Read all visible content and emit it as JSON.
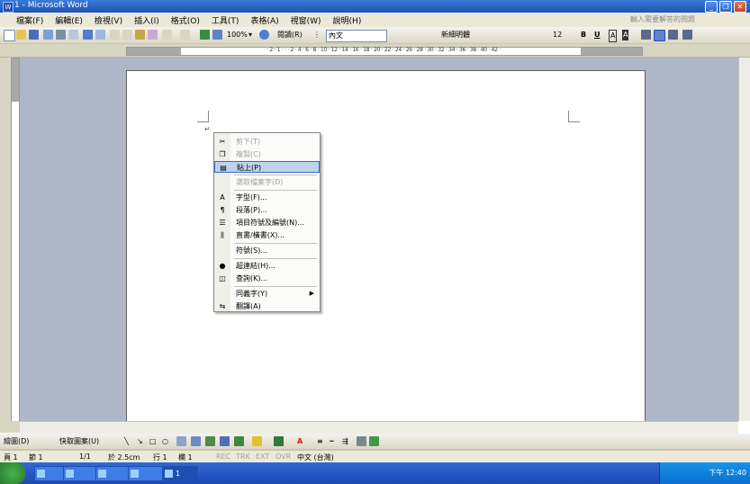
{
  "window": {
    "title": "1 - Microsoft Word"
  },
  "menubar": {
    "items": [
      "檔案(F)",
      "編輯(E)",
      "檢視(V)",
      "插入(I)",
      "格式(O)",
      "工具(T)",
      "表格(A)",
      "視窗(W)",
      "說明(H)"
    ],
    "help_placeholder": "輸入需要解答的問題"
  },
  "toolbar": {
    "zoom": "100%",
    "read_label": "閱讀(R)",
    "style": "內文",
    "font": "新細明體",
    "size": "12",
    "bold": "B",
    "underline": "U",
    "char_a": "A"
  },
  "context_menu": {
    "items": [
      {
        "label": "剪下(T)",
        "icon": "scissors-icon",
        "glyph": "✂",
        "disabled": true
      },
      {
        "label": "複製(C)",
        "icon": "copy-icon",
        "glyph": "❐",
        "disabled": true
      },
      {
        "label": "貼上(P)",
        "icon": "paste-icon",
        "glyph": "▤",
        "disabled": false,
        "highlighted": true
      },
      {
        "label": "選取檔案字(D)",
        "icon": "",
        "glyph": "",
        "disabled": true
      },
      {
        "label": "字型(F)...",
        "icon": "font-icon",
        "glyph": "A",
        "disabled": false
      },
      {
        "label": "段落(P)...",
        "icon": "paragraph-icon",
        "glyph": "¶",
        "disabled": false
      },
      {
        "label": "項目符號及編號(N)...",
        "icon": "bullets-icon",
        "glyph": "☰",
        "disabled": false
      },
      {
        "label": "直書/橫書(X)...",
        "icon": "text-direction-icon",
        "glyph": "⫼",
        "disabled": false
      },
      {
        "label": "符號(S)...",
        "icon": "",
        "glyph": "",
        "disabled": false
      },
      {
        "label": "超連結(H)...",
        "icon": "hyperlink-icon",
        "glyph": "●",
        "disabled": false
      },
      {
        "label": "查詢(K)...",
        "icon": "lookup-icon",
        "glyph": "◫",
        "disabled": false
      },
      {
        "label": "同義字(Y)",
        "icon": "",
        "glyph": "",
        "disabled": false,
        "submenu": true
      },
      {
        "label": "翻譯(A)",
        "icon": "translate-icon",
        "glyph": "⇆",
        "disabled": false
      }
    ]
  },
  "drawbar": {
    "draw_label": "繪圖(D)",
    "autoshapes_label": "快取圖案(U)"
  },
  "statusbar": {
    "page": "頁 1",
    "section": "節 1",
    "pages": "1/1",
    "position": "於 2.5cm",
    "line": "行 1",
    "column": "欄 1",
    "rec": "REC",
    "trk": "TRK",
    "ext": "EXT",
    "ovr": "OVR",
    "lang": "中文 (台灣)"
  },
  "taskbar": {
    "tasks": [
      "",
      "",
      "",
      ""
    ],
    "word_task": "1",
    "clock": "下午 12:40"
  },
  "colors": {
    "title_blue": "#1c55b8",
    "menu_highlight": "#c1d2ee",
    "highlight_border": "#316ac5",
    "doc_bg": "#aeb7c7"
  }
}
